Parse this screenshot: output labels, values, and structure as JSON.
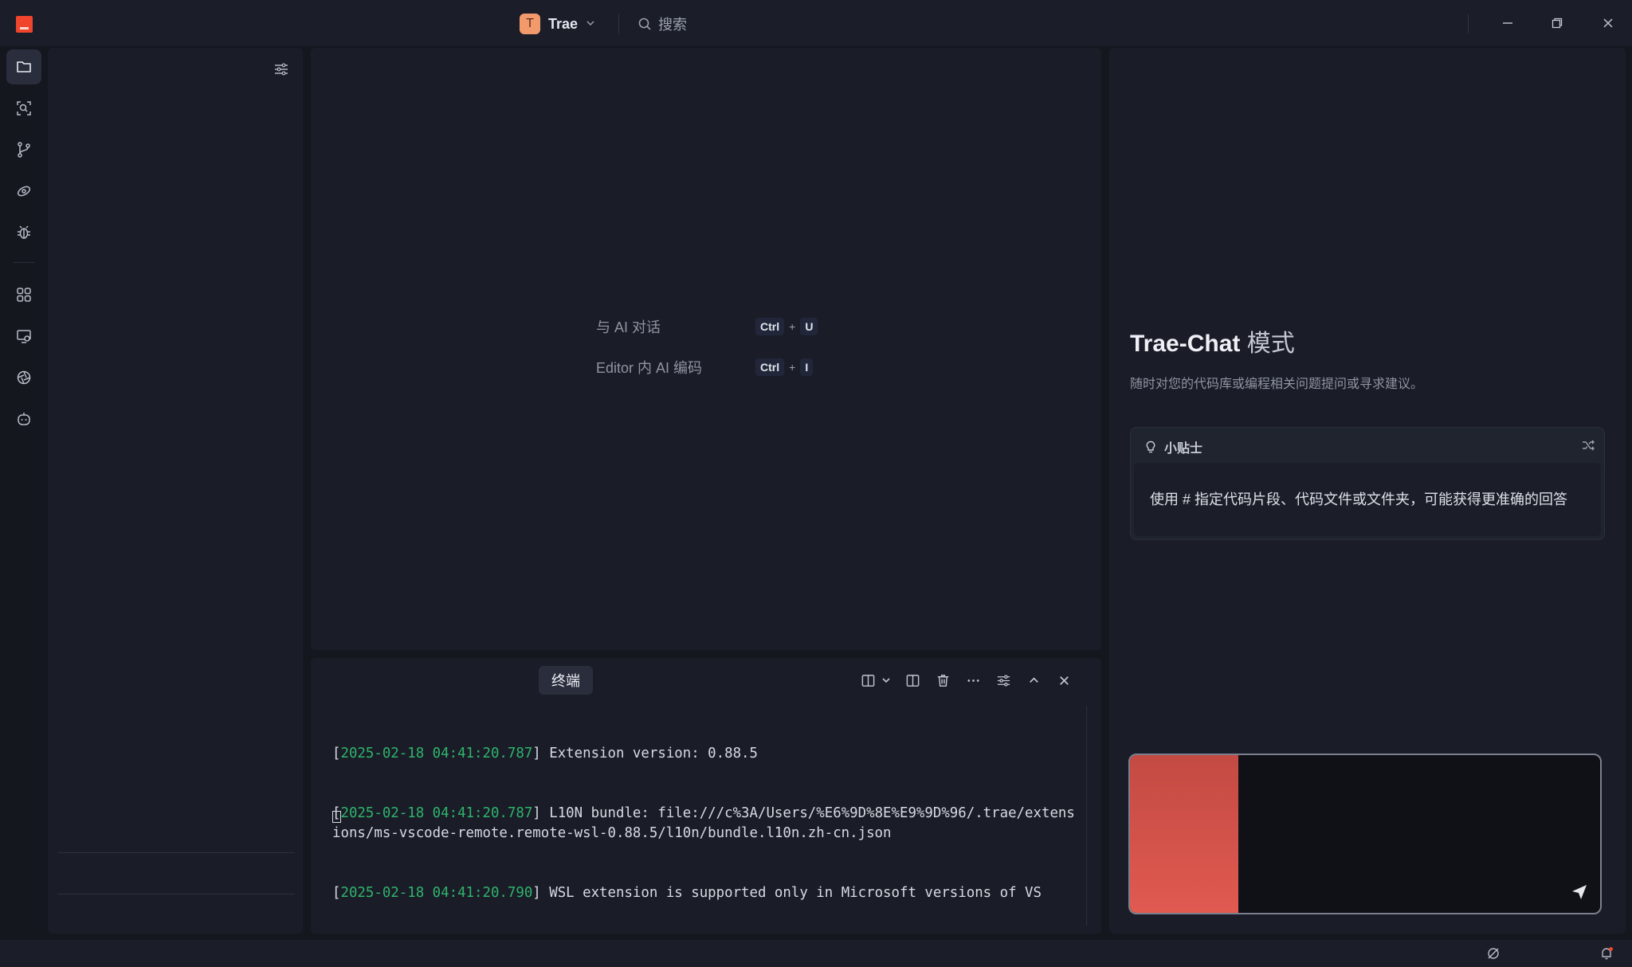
{
  "titlebar": {
    "project_badge": "T",
    "project_name": "Trae",
    "search_placeholder": "搜索"
  },
  "activity_bar": {
    "items": [
      "explorer",
      "search",
      "source-control",
      "remote",
      "debug",
      "extensions",
      "remote-explorer",
      "agents",
      "ai"
    ]
  },
  "editor": {
    "shortcuts": [
      {
        "label": "与 AI 对话",
        "key1": "Ctrl",
        "plus": "+",
        "key2": "U"
      },
      {
        "label": "Editor 内 AI 编码",
        "key1": "Ctrl",
        "plus": "+",
        "key2": "I"
      }
    ]
  },
  "terminal": {
    "tab_label": "终端",
    "lines": [
      {
        "open": "[",
        "ts": "2025-02-18 04:41:20.787",
        "msg": "] Extension version: 0.88.5"
      },
      {
        "open": "[",
        "ts": "2025-02-18 04:41:20.787",
        "msg": "] L10N bundle: file:///c%3A/Users/%E6%9D%8E%E9%9D%96/.trae/extensions/ms-vscode-remote.remote-wsl-0.88.5/l10n/bundle.l10n.zh-cn.json"
      },
      {
        "open": "[",
        "ts": "2025-02-18 04:41:20.790",
        "msg": "] WSL extension is supported only in Microsoft versions of VS"
      }
    ]
  },
  "chat": {
    "title": "Trae-Chat",
    "mode": " 模式",
    "description": "随时对您的代码库或编程相关问题提问或寻求建议。",
    "tip_title": "小贴士",
    "tip_body": "使用 # 指定代码片段、代码文件或文件夹，可能获得更准确的回答"
  },
  "colors": {
    "background": "#15171f",
    "panel": "#1a1d28",
    "accent": "#f0442d",
    "timestamp": "#2fb36a"
  }
}
